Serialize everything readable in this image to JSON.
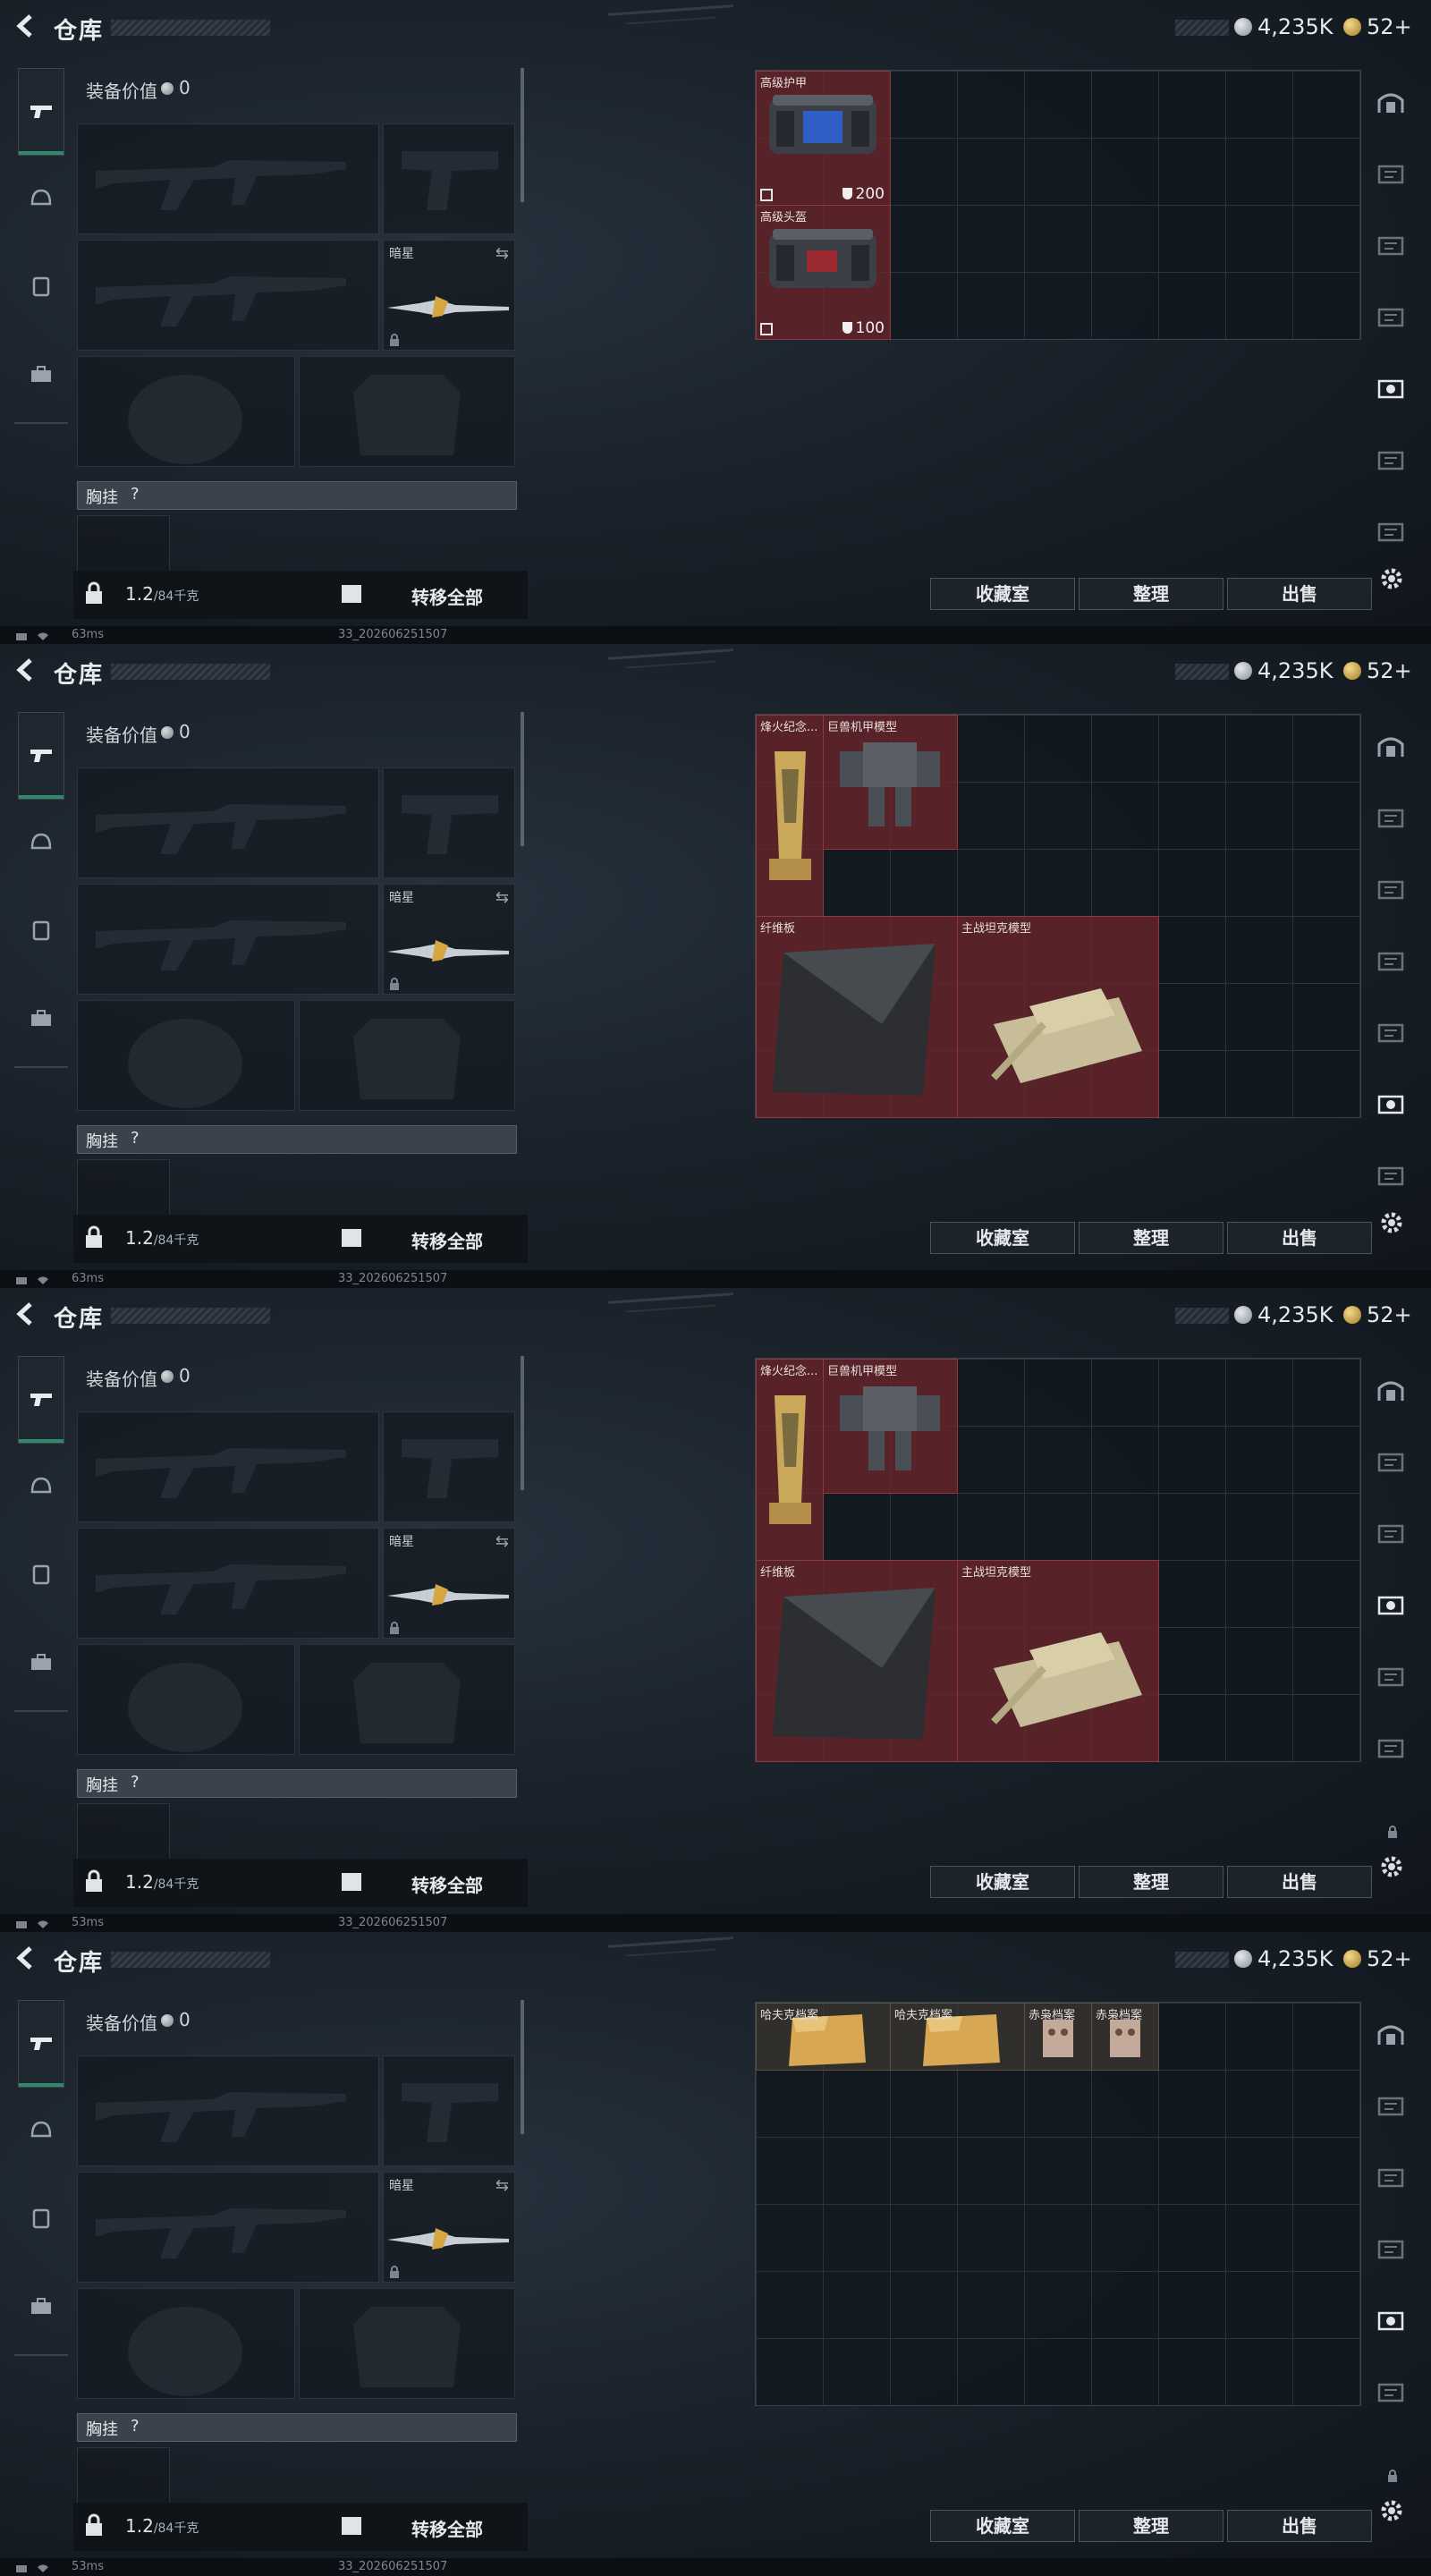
{
  "title": "仓库",
  "currency": {
    "silver": "4,235K",
    "gold": "52+"
  },
  "equipment": {
    "value_label": "装备价值",
    "value": "0",
    "secondary_slot_label": "暗星",
    "chest_label": "胸挂",
    "chest_help": "?",
    "weight": "1.2",
    "weight_limit": "/84千克",
    "transfer_all": "转移全部"
  },
  "buttons": {
    "collection": "收藏室",
    "sort": "整理",
    "sell": "出售"
  },
  "status": {
    "build": "33_202606251507"
  },
  "panels": [
    {
      "ping": "63ms",
      "items": [
        {
          "name": "高级护甲",
          "stat": "200",
          "icon": "armor-case-icon"
        },
        {
          "name": "高级头盔",
          "stat": "100",
          "icon": "helmet-case-icon"
        }
      ]
    },
    {
      "ping": "63ms",
      "items": [
        {
          "name": "烽火纪念...",
          "icon": "trophy-icon"
        },
        {
          "name": "巨兽机甲模型",
          "icon": "mech-model-icon"
        },
        {
          "name": "纤维板",
          "icon": "fiberboard-icon"
        },
        {
          "name": "主战坦克模型",
          "icon": "tank-model-icon"
        }
      ]
    },
    {
      "ping": "53ms",
      "items": [
        {
          "name": "烽火纪念...",
          "icon": "trophy-icon"
        },
        {
          "name": "巨兽机甲模型",
          "icon": "mech-model-icon"
        },
        {
          "name": "纤维板",
          "icon": "fiberboard-icon"
        },
        {
          "name": "主战坦克模型",
          "icon": "tank-model-icon"
        }
      ]
    },
    {
      "ping": "53ms",
      "items": [
        {
          "name": "哈夫克档案",
          "icon": "document-folder-icon"
        },
        {
          "name": "哈夫克档案",
          "icon": "document-folder-icon"
        },
        {
          "name": "赤枭档案",
          "icon": "owl-file-icon"
        },
        {
          "name": "赤枭档案",
          "icon": "owl-file-icon"
        }
      ]
    }
  ]
}
